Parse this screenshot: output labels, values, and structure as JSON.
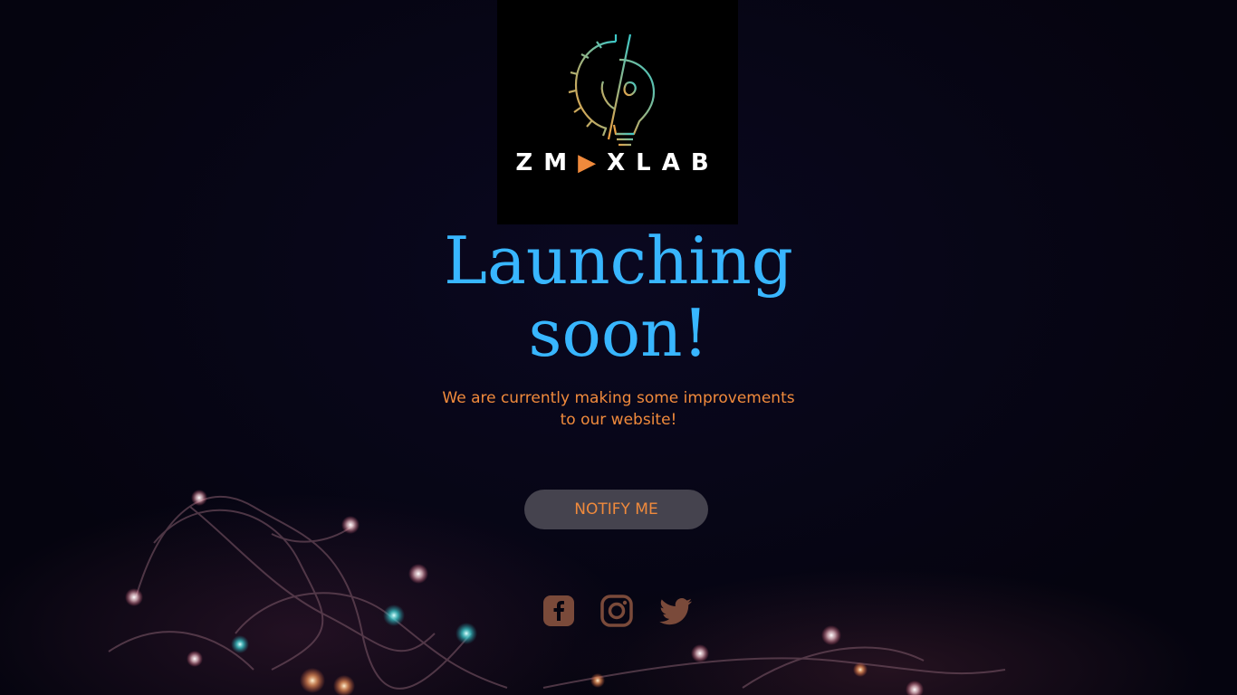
{
  "brand": {
    "name_part1": "ZM",
    "name_part2": "XLAB",
    "logo_icon": "gear-lightbulb-icon",
    "play_icon": "play-triangle-icon",
    "accent_color": "#f08a3c",
    "logo_gradient": [
      "#f0a040",
      "#3cc8c8"
    ]
  },
  "hero": {
    "headline": "Launching soon!",
    "subtext": "We are currently making some improvements to our website!",
    "headline_color": "#38b6ff"
  },
  "cta": {
    "notify_label": "NOTIFY ME"
  },
  "social": [
    {
      "name": "facebook",
      "icon": "facebook-icon"
    },
    {
      "name": "instagram",
      "icon": "instagram-icon"
    },
    {
      "name": "twitter",
      "icon": "twitter-icon"
    }
  ],
  "colors": {
    "background": "#05040f",
    "button_bg": "#45434e",
    "social_icon": "#7a4a3a"
  }
}
